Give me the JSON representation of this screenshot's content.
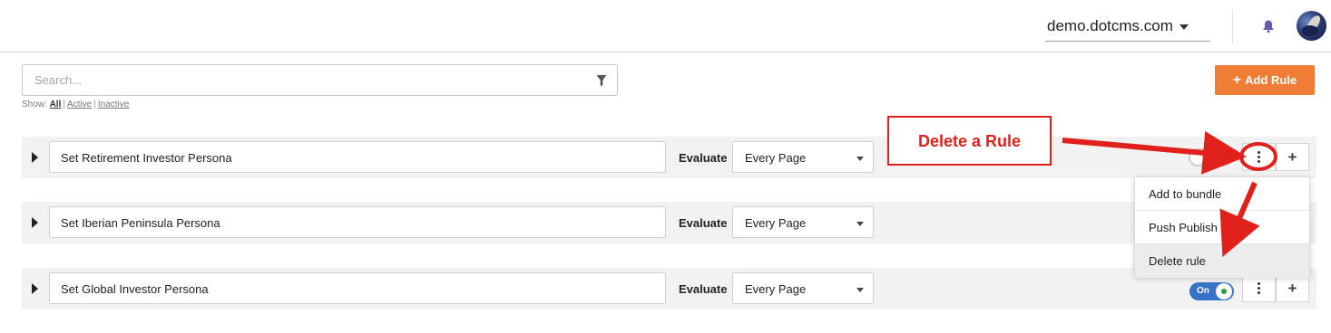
{
  "header": {
    "site": "demo.dotcms.com"
  },
  "search": {
    "placeholder": "Search..."
  },
  "show_filter": {
    "label": "Show:",
    "options": [
      "All",
      "Active",
      "Inactive"
    ],
    "selected": "All"
  },
  "add_rule": {
    "label": "Add Rule"
  },
  "evaluate_label": "Evaluate",
  "rules": [
    {
      "name": "Set Retirement Investor Persona",
      "fire_on": "Every Page",
      "toggle": "Off",
      "enabled": false
    },
    {
      "name": "Set Iberian Peninsula Persona",
      "fire_on": "Every Page"
    },
    {
      "name": "Set Global Investor Persona",
      "fire_on": "Every Page",
      "toggle": "On",
      "enabled": true
    }
  ],
  "rule_menu": {
    "items": [
      "Add to bundle",
      "Push Publish",
      "Delete rule"
    ]
  },
  "annotation": {
    "callout": "Delete a Rule",
    "color": "#e0201b"
  },
  "colors": {
    "accent": "#f07d36",
    "toggle_on": "#3672c6",
    "toggle_dot": "#2d9d3c"
  }
}
